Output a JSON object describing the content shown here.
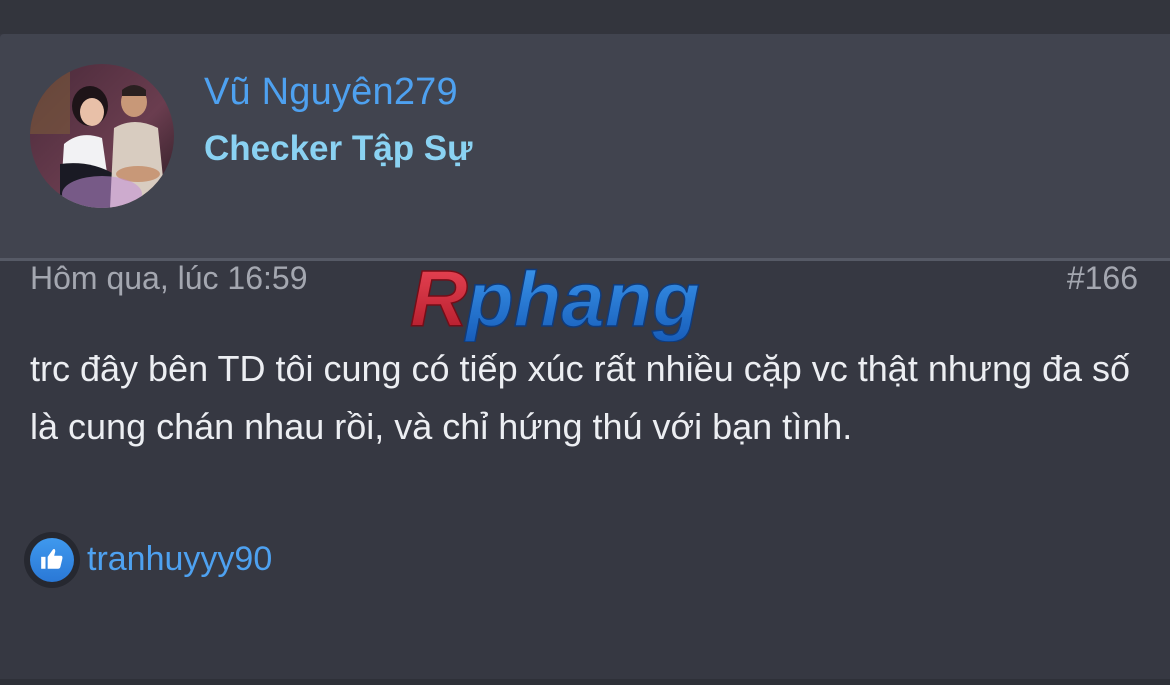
{
  "post": {
    "author": {
      "name": "Vũ Nguyên279",
      "title": "Checker Tập Sự"
    },
    "time": "Hôm qua, lúc 16:59",
    "number": "#166",
    "body": "trc đây bên TD tôi cung có tiếp xúc rất nhiều cặp vc thật nhưng đa số là cung chán nhau rồi, và chỉ hứng thú với bạn tình.",
    "reactions": {
      "icon": "like-icon",
      "users": "tranhuyyy90"
    }
  },
  "watermark": {
    "text": "Rphang"
  },
  "colors": {
    "background": "#2e3038",
    "header_bg": "#41444f",
    "link_blue": "#4ea1f0",
    "title_cyan": "#8ad2f2",
    "meta_gray": "#a4a7b0",
    "body_text": "#eceef2"
  }
}
